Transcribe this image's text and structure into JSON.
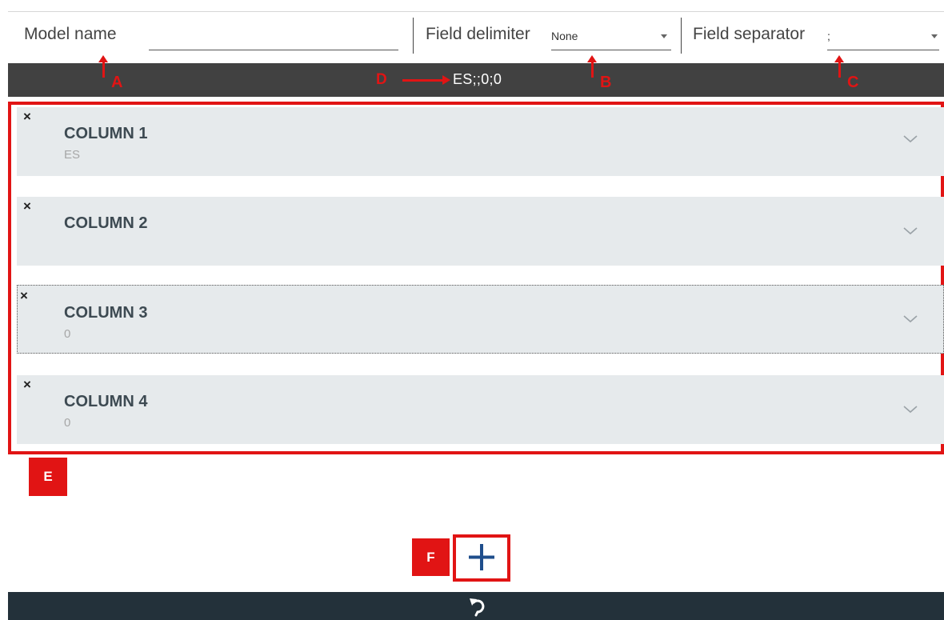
{
  "toolbar": {
    "model_name_label": "Model name",
    "model_name_value": "",
    "field_delimiter_label": "Field delimiter",
    "field_delimiter_value": "None",
    "field_separator_label": "Field separator",
    "field_separator_value": ";"
  },
  "preview": {
    "text": "ES;;0;0"
  },
  "annotations": {
    "a": "A",
    "b": "B",
    "c": "C",
    "d": "D",
    "e": "E",
    "f": "F",
    "color": "#e11414"
  },
  "columns": [
    {
      "title": "COLUMN 1",
      "value": "ES",
      "remove": "×"
    },
    {
      "title": "COLUMN 2",
      "value": "",
      "remove": "×"
    },
    {
      "title": "COLUMN 3",
      "value": "0",
      "remove": "×"
    },
    {
      "title": "COLUMN 4",
      "value": "0",
      "remove": "×"
    }
  ],
  "icons": {
    "remove": "close-icon",
    "expand": "chevron-down-icon",
    "add": "plus-icon",
    "undo": "undo-icon"
  },
  "colors": {
    "preview_bar": "#414141",
    "column_bg": "#e6eaec",
    "footer_bg": "#23313a",
    "add_icon": "#1f4e8c"
  }
}
